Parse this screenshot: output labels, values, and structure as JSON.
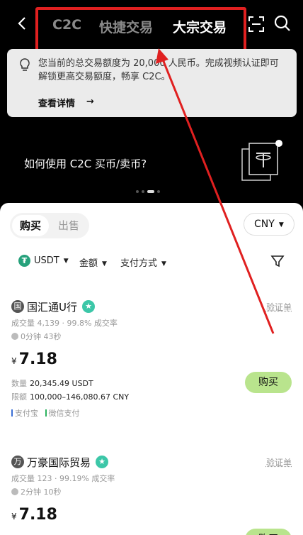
{
  "header": {
    "tabs": [
      "C2C",
      "快捷交易",
      "大宗交易"
    ],
    "icons": [
      "back-icon",
      "scan-icon",
      "search-icon"
    ]
  },
  "notice": {
    "message": "您当前的总交易额度为 20,000 人民币。完成视频认证即可解锁更高交易额度，畅享 C2C。",
    "link_label": "查看详情",
    "arrow": "→"
  },
  "banner": {
    "text": "如何使用 C2C 买币/卖币?"
  },
  "segment": {
    "buy_label": "购买",
    "sell_label": "出售"
  },
  "currency": "CNY",
  "filters": {
    "coin": "USDT",
    "amount": "金额",
    "payment": "支付方式",
    "caret": "▼"
  },
  "offers": [
    {
      "avatar_text": "国",
      "name": "国汇通U行",
      "verify_label": "验证单",
      "stats": "成交量 4,139 · 99.8% 成交率",
      "time": "0分钟 43秒",
      "currency_symbol": "¥",
      "price": "7.18",
      "quantity_label": "数量",
      "quantity": "20,345.49 USDT",
      "limit_label": "限额",
      "limit": "100,000–146,080.67 CNY",
      "payments": [
        "支付宝",
        "微信支付"
      ],
      "buy_label": "购买"
    },
    {
      "avatar_text": "万",
      "name": "万豪国际贸易",
      "verify_label": "验证单",
      "stats": "成交量 123 · 99.19% 成交率",
      "time": "2分钟 10秒",
      "currency_symbol": "¥",
      "price": "7.18",
      "buy_label": "购买"
    }
  ],
  "colors": {
    "annotation_red": "#e02020",
    "buy_green": "#b9e48d",
    "badge_teal": "#3cc7a8",
    "alipay_blue": "#3b6fd6",
    "wechat_green": "#2db35f"
  }
}
